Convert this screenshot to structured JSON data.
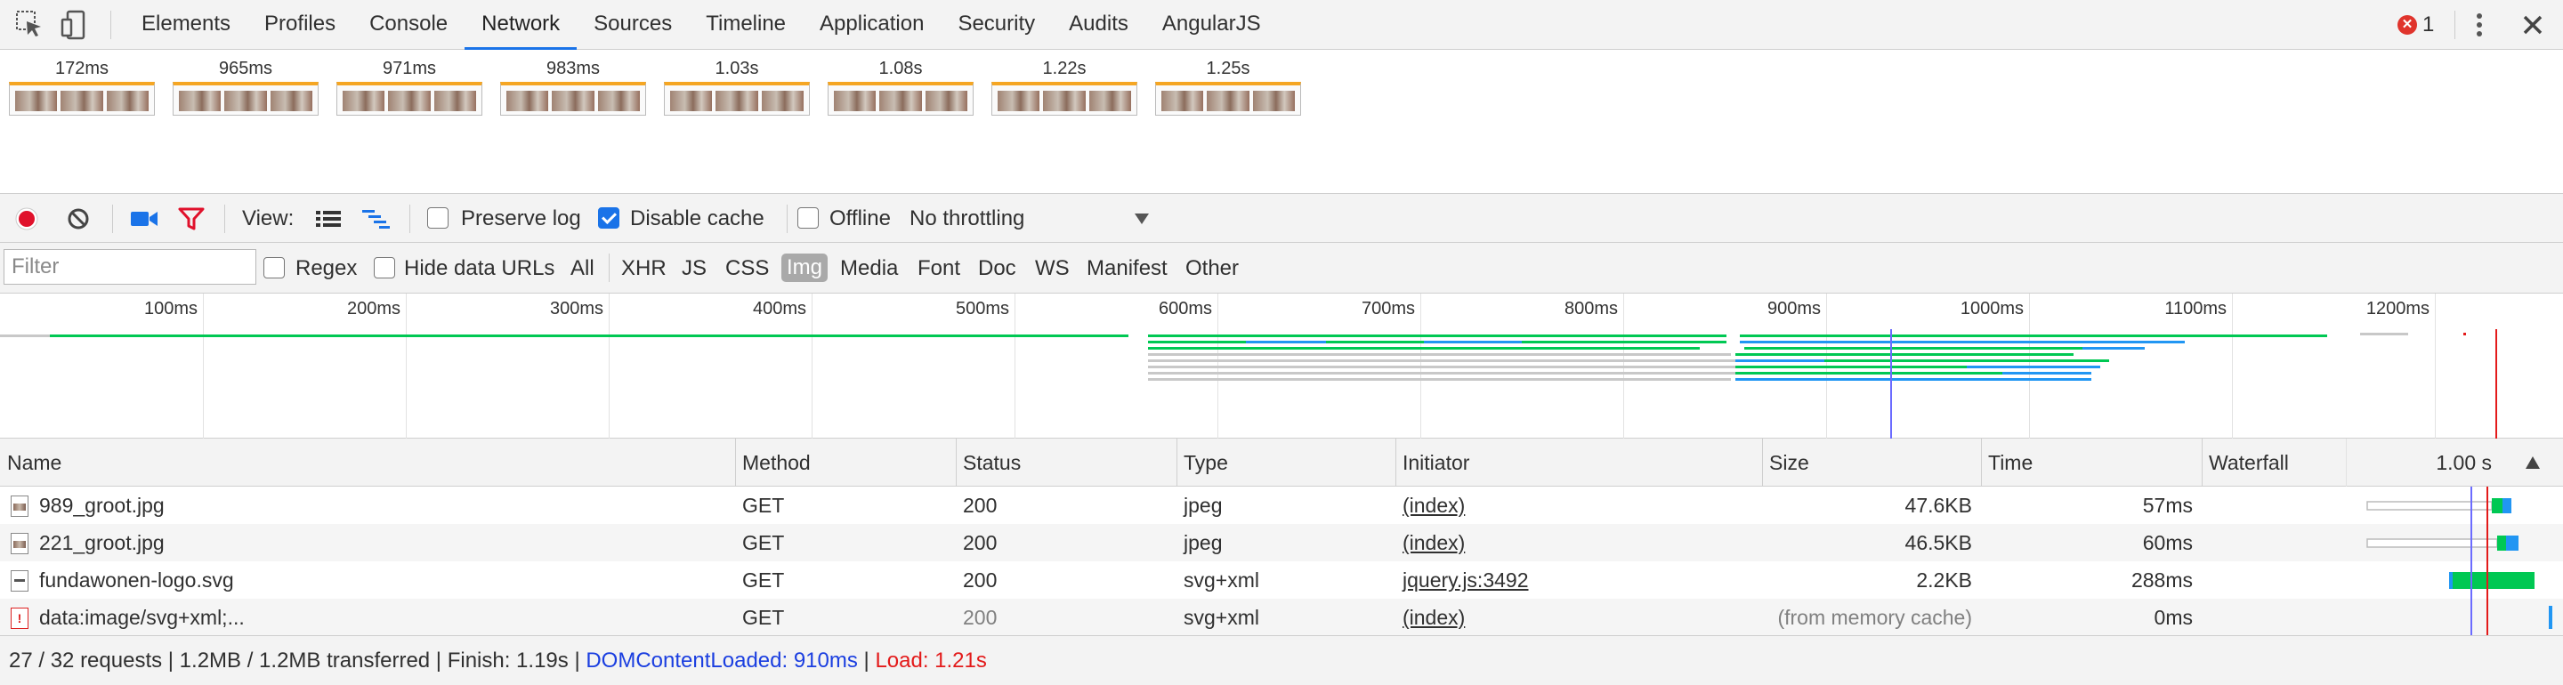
{
  "tabbar": {
    "tabs": [
      "Elements",
      "Profiles",
      "Console",
      "Network",
      "Sources",
      "Timeline",
      "Application",
      "Security",
      "Audits",
      "AngularJS"
    ],
    "active": "Network",
    "error_count": "1"
  },
  "filmstrip": {
    "frames": [
      "172ms",
      "965ms",
      "971ms",
      "983ms",
      "1.03s",
      "1.08s",
      "1.22s",
      "1.25s"
    ]
  },
  "toolbar": {
    "view_label": "View:",
    "preserve_log": "Preserve log",
    "disable_cache": "Disable cache",
    "offline": "Offline",
    "throttling": "No throttling",
    "preserve_log_checked": false,
    "disable_cache_checked": true,
    "offline_checked": false
  },
  "filterbar": {
    "placeholder": "Filter",
    "regex": "Regex",
    "hide_data_urls": "Hide data URLs",
    "types": [
      "All",
      "XHR",
      "JS",
      "CSS",
      "Img",
      "Media",
      "Font",
      "Doc",
      "WS",
      "Manifest",
      "Other"
    ],
    "active_type": "Img"
  },
  "overview": {
    "ticks": [
      "100ms",
      "200ms",
      "300ms",
      "400ms",
      "500ms",
      "600ms",
      "700ms",
      "800ms",
      "900ms",
      "1000ms",
      "1100ms",
      "1200ms"
    ]
  },
  "table": {
    "columns": {
      "name": "Name",
      "method": "Method",
      "status": "Status",
      "type": "Type",
      "initiator": "Initiator",
      "size": "Size",
      "time": "Time",
      "waterfall": "Waterfall",
      "waterfall_scale": "1.00 s"
    },
    "rows": [
      {
        "name": "989_groot.jpg",
        "method": "GET",
        "status": "200",
        "type": "jpeg",
        "initiator": "(index)",
        "size": "47.6KB",
        "time": "57ms",
        "icon": "image-file-icon",
        "waterfall_start": 0.955,
        "waterfall_end": 1.012
      },
      {
        "name": "221_groot.jpg",
        "method": "GET",
        "status": "200",
        "type": "jpeg",
        "initiator": "(index)",
        "size": "46.5KB",
        "time": "60ms",
        "icon": "image-file-icon",
        "waterfall_start": 0.96,
        "waterfall_end": 1.02
      },
      {
        "name": "fundawonen-logo.svg",
        "method": "GET",
        "status": "200",
        "type": "svg+xml",
        "initiator": "jquery.js:3492",
        "size": "2.2KB",
        "time": "288ms",
        "icon": "svg-file-icon",
        "waterfall_start": 0.83,
        "waterfall_end": 1.118
      },
      {
        "name": "data:image/svg+xml;...",
        "method": "GET",
        "status": "200",
        "type": "svg+xml",
        "initiator": "(index)",
        "size": "(from memory cache)",
        "time": "0ms",
        "icon": "data-uri-icon",
        "waterfall_start": 1.19,
        "waterfall_end": 1.19
      }
    ]
  },
  "statusbar": {
    "summary": "27 / 32 requests | 1.2MB / 1.2MB transferred | Finish: 1.19s | ",
    "dom_content_loaded": "DOMContentLoaded: 910ms",
    "separator": " | ",
    "load": "Load: 1.21s"
  },
  "colors": {
    "accent": "#1a73e8",
    "waiting": "#00c853",
    "download": "#2196f3",
    "error": "#e0342c",
    "dcl_line": "#1a3ee0",
    "load_line": "#e31a1a"
  }
}
